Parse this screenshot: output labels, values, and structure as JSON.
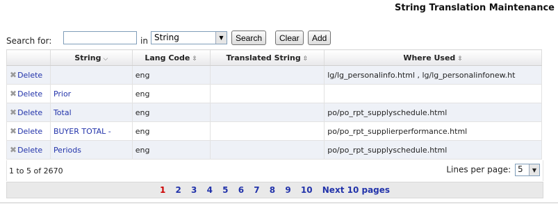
{
  "title": "String Translation Maintenance",
  "search": {
    "label": "Search for:",
    "value": "",
    "in_label": "in",
    "field_selected": "String",
    "search_button": "Search",
    "clear_button": "Clear",
    "add_button": "Add"
  },
  "table": {
    "columns": [
      "String",
      "Lang Code",
      "Translated String",
      "Where Used"
    ],
    "sorted_column": "String",
    "rows": [
      {
        "action": "Delete",
        "string": "",
        "lang_code": "eng",
        "translated": "",
        "where_used": "lg/lg_personalinfo.html , lg/lg_personalinfonew.ht"
      },
      {
        "action": "Delete",
        "string": "Prior",
        "lang_code": "eng",
        "translated": "",
        "where_used": ""
      },
      {
        "action": "Delete",
        "string": "Total",
        "lang_code": "eng",
        "translated": "",
        "where_used": "po/po_rpt_supplyschedule.html"
      },
      {
        "action": "Delete",
        "string": "BUYER TOTAL -",
        "lang_code": "eng",
        "translated": "",
        "where_used": "po/po_rpt_supplierperformance.html"
      },
      {
        "action": "Delete",
        "string": "Periods",
        "lang_code": "eng",
        "translated": "",
        "where_used": "po/po_rpt_supplyschedule.html"
      }
    ]
  },
  "footer": {
    "count_text": "1 to 5 of 2670",
    "lines_per_page_label": "Lines per page:",
    "lines_per_page_value": "5"
  },
  "pagination": {
    "current": "1",
    "pages": [
      "2",
      "3",
      "4",
      "5",
      "6",
      "7",
      "8",
      "9",
      "10"
    ],
    "next_label": "Next 10 pages"
  },
  "colors": {
    "link": "#2233aa",
    "current_page": "#cc0000",
    "row_alt": "#eef1f7"
  },
  "icons": {
    "delete": "x-icon",
    "sort": "sort-arrows-icon",
    "sort_active": "chevron-down-icon"
  }
}
